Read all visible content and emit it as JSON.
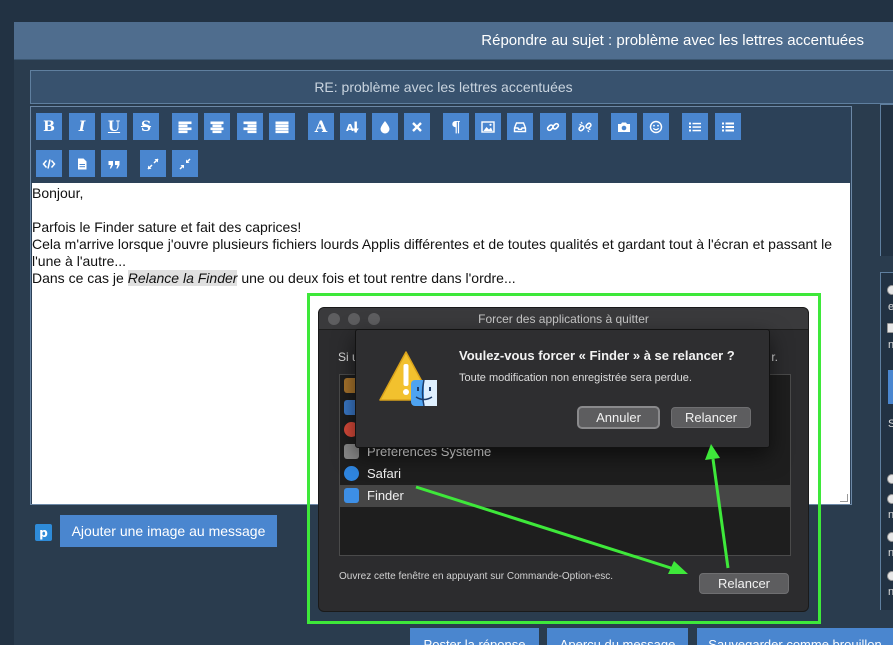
{
  "page": {
    "title": "Répondre au sujet : problème avec les lettres accentuées",
    "subject": "RE: problème avec les lettres accentuées"
  },
  "toolbar": {
    "buttons": [
      {
        "name": "bold-button",
        "glyph": "B"
      },
      {
        "name": "italic-button",
        "glyph": "I"
      },
      {
        "name": "underline-button",
        "glyph": "U"
      },
      {
        "name": "strikethrough-button",
        "glyph": "S"
      },
      {
        "name": "align-left-button",
        "icon": "align-left-icon"
      },
      {
        "name": "align-center-button",
        "icon": "align-center-icon"
      },
      {
        "name": "align-right-button",
        "icon": "align-right-icon"
      },
      {
        "name": "justify-button",
        "icon": "justify-icon"
      },
      {
        "name": "font-button",
        "glyph": "A"
      },
      {
        "name": "font-size-button",
        "icon": "font-size-icon"
      },
      {
        "name": "color-button",
        "icon": "droplet-icon"
      },
      {
        "name": "remove-format-button",
        "icon": "remove-format-icon"
      },
      {
        "name": "paragraph-button",
        "glyph": "¶"
      },
      {
        "name": "image-button",
        "icon": "image-icon"
      },
      {
        "name": "embed-button",
        "icon": "inbox-icon"
      },
      {
        "name": "link-button",
        "icon": "link-icon"
      },
      {
        "name": "unlink-button",
        "icon": "unlink-icon"
      },
      {
        "name": "camera-button",
        "icon": "camera-icon"
      },
      {
        "name": "emoji-button",
        "icon": "smiley-icon"
      },
      {
        "name": "bullet-list-button",
        "icon": "bullet-list-icon"
      },
      {
        "name": "numbered-list-button",
        "icon": "numbered-list-icon"
      },
      {
        "name": "source-button",
        "icon": "code-icon"
      },
      {
        "name": "document-button",
        "icon": "document-icon"
      },
      {
        "name": "quote-button",
        "icon": "quote-icon"
      },
      {
        "name": "expand-button",
        "icon": "expand-icon"
      },
      {
        "name": "collapse-button",
        "icon": "collapse-icon"
      }
    ]
  },
  "editor": {
    "line1": "Bonjour,",
    "line2": "Parfois le Finder sature et fait des caprices!",
    "line3": "Cela m'arrive lorsque j'ouvre plusieurs fichiers lourds Applis différentes et de toutes qualités et gardant tout à l'écran et passant le l'une à l'autre...",
    "line4_before": "Dans ce cas je ",
    "line4_highlight": "Relance la Finder",
    "line4_after": " une ou deux fois et tout rentre dans l'ordre..."
  },
  "upload": {
    "icon_letter": "p",
    "button_label": "Ajouter une image au message"
  },
  "bottom_buttons": [
    "Poster la réponse",
    "Aperçu du message",
    "Sauvegarder comme brouillon"
  ],
  "right_panel": {
    "chars": [
      "e",
      "n",
      "S",
      "n",
      "n",
      "n",
      "n"
    ]
  },
  "force_quit": {
    "title": "Forcer des applications à quitter",
    "instruction_left": "Si u",
    "instruction_right": "r.",
    "apps": [
      {
        "label": "",
        "icon_color": "#a8742c"
      },
      {
        "label": "",
        "icon_color": "#3a78c8"
      },
      {
        "label": "",
        "icon_color": "#d94a3a"
      },
      {
        "label": "Préférences Système",
        "icon_color": "#8a8a8a"
      },
      {
        "label": "Safari",
        "icon_color": "#2f86e0"
      },
      {
        "label": "Finder",
        "icon_color": "#3d8fe6"
      }
    ],
    "selected_app": "Finder",
    "footer": "Ouvrez cette fenêtre en appuyant sur Commande-Option-esc.",
    "relaunch_label": "Relancer"
  },
  "alert": {
    "title": "Voulez-vous forcer « Finder » à se relancer ?",
    "message": "Toute modification non enregistrée sera perdue.",
    "cancel_label": "Annuler",
    "relaunch_label": "Relancer"
  },
  "colors": {
    "annotation_green": "#3ee83a",
    "accent_blue": "#4a86cf",
    "header_blue": "#4f6d8e"
  }
}
